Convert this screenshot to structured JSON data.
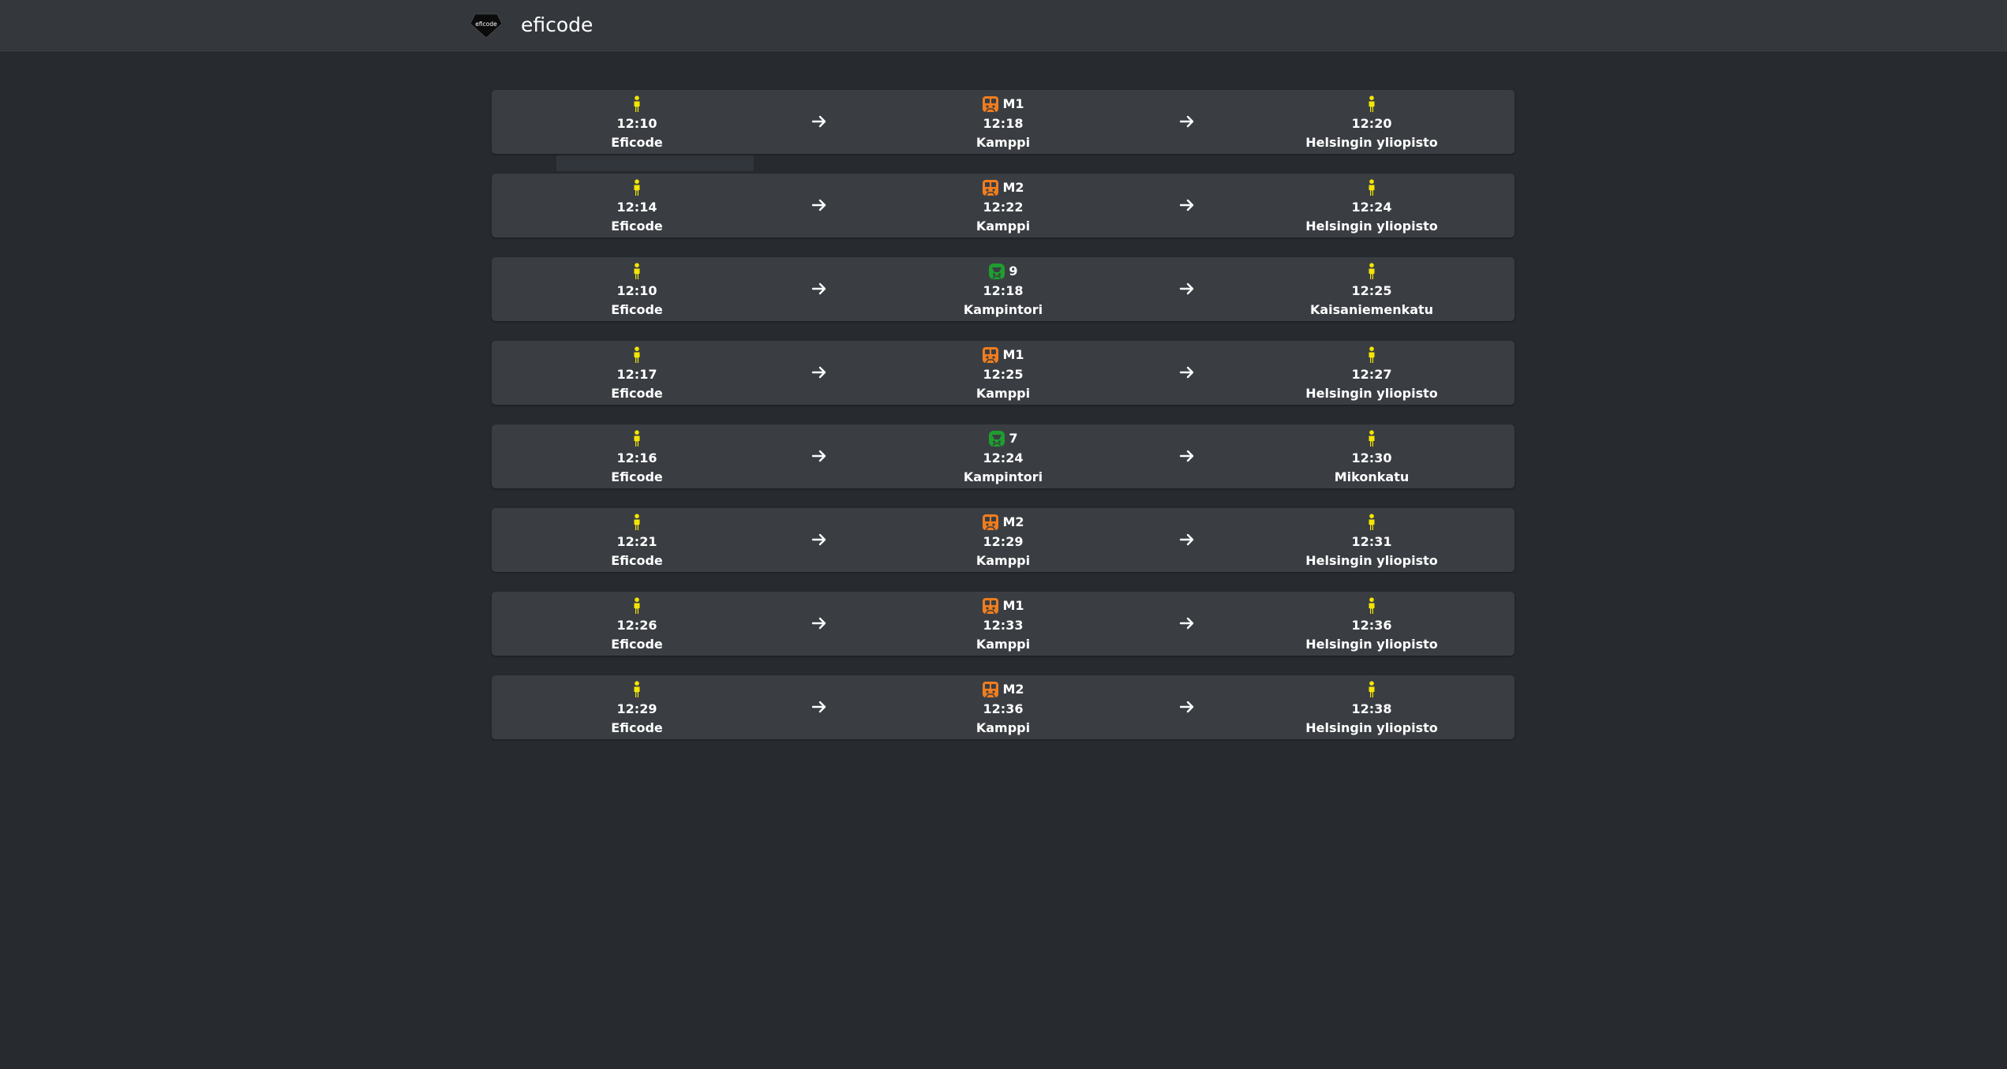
{
  "header": {
    "logo_text": "eficode",
    "brand": "eficode"
  },
  "colors": {
    "walk": "#f5e600",
    "metro": "#f07d1e",
    "tram": "#1f9d2e",
    "background": "#272a2e",
    "card": "#3a3e43"
  },
  "routes": [
    {
      "origin": {
        "icon": "walk-icon",
        "time": "12:10",
        "place": "Eficode"
      },
      "transit": {
        "icon": "metro-icon",
        "line": "M1",
        "time": "12:18",
        "place": "Kamppi"
      },
      "destination": {
        "icon": "walk-icon",
        "time": "12:20",
        "place": "Helsingin yliopisto"
      }
    },
    {
      "origin": {
        "icon": "walk-icon",
        "time": "12:14",
        "place": "Eficode"
      },
      "transit": {
        "icon": "metro-icon",
        "line": "M2",
        "time": "12:22",
        "place": "Kamppi"
      },
      "destination": {
        "icon": "walk-icon",
        "time": "12:24",
        "place": "Helsingin yliopisto"
      }
    },
    {
      "origin": {
        "icon": "walk-icon",
        "time": "12:10",
        "place": "Eficode"
      },
      "transit": {
        "icon": "tram-icon",
        "line": "9",
        "time": "12:18",
        "place": "Kampintori"
      },
      "destination": {
        "icon": "walk-icon",
        "time": "12:25",
        "place": "Kaisaniemenkatu"
      }
    },
    {
      "origin": {
        "icon": "walk-icon",
        "time": "12:17",
        "place": "Eficode"
      },
      "transit": {
        "icon": "metro-icon",
        "line": "M1",
        "time": "12:25",
        "place": "Kamppi"
      },
      "destination": {
        "icon": "walk-icon",
        "time": "12:27",
        "place": "Helsingin yliopisto"
      }
    },
    {
      "origin": {
        "icon": "walk-icon",
        "time": "12:16",
        "place": "Eficode"
      },
      "transit": {
        "icon": "tram-icon",
        "line": "7",
        "time": "12:24",
        "place": "Kampintori"
      },
      "destination": {
        "icon": "walk-icon",
        "time": "12:30",
        "place": "Mikonkatu"
      }
    },
    {
      "origin": {
        "icon": "walk-icon",
        "time": "12:21",
        "place": "Eficode"
      },
      "transit": {
        "icon": "metro-icon",
        "line": "M2",
        "time": "12:29",
        "place": "Kamppi"
      },
      "destination": {
        "icon": "walk-icon",
        "time": "12:31",
        "place": "Helsingin yliopisto"
      }
    },
    {
      "origin": {
        "icon": "walk-icon",
        "time": "12:26",
        "place": "Eficode"
      },
      "transit": {
        "icon": "metro-icon",
        "line": "M1",
        "time": "12:33",
        "place": "Kamppi"
      },
      "destination": {
        "icon": "walk-icon",
        "time": "12:36",
        "place": "Helsingin yliopisto"
      }
    },
    {
      "origin": {
        "icon": "walk-icon",
        "time": "12:29",
        "place": "Eficode"
      },
      "transit": {
        "icon": "metro-icon",
        "line": "M2",
        "time": "12:36",
        "place": "Kamppi"
      },
      "destination": {
        "icon": "walk-icon",
        "time": "12:38",
        "place": "Helsingin yliopisto"
      }
    }
  ]
}
